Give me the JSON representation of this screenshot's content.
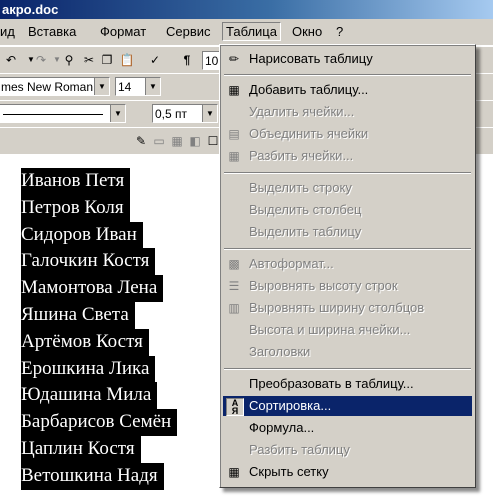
{
  "window": {
    "title": "акро.doc"
  },
  "menubar": [
    "ид",
    "Вставка",
    "Формат",
    "Сервис",
    "Таблица",
    "Окно",
    "?"
  ],
  "toolbar_format": {
    "font": "mes New Roman",
    "size": "14",
    "line_width": "0,5 пт"
  },
  "toolbar_std": {
    "zoom": "10"
  },
  "document": {
    "names": [
      "Иванов Петя",
      "Петров Коля",
      "Сидоров Иван",
      "Галочкин Костя",
      "Мамонтова Лена",
      "Яшина Света",
      "Артёмов Костя",
      "Ерошкина Лика",
      "Юдашина Мила",
      "Барбарисов Семён",
      "Цаплин Костя",
      "Ветошкина Надя"
    ]
  },
  "table_menu": {
    "items": [
      {
        "label": "Нарисовать таблицу",
        "icon": "pencil-icon",
        "enabled": true
      },
      {
        "label": "Добавить таблицу...",
        "icon": "insert-table-icon",
        "enabled": true
      },
      {
        "label": "Удалить ячейки...",
        "icon": "",
        "enabled": false
      },
      {
        "label": "Объединить ячейки",
        "icon": "merge-cells-icon",
        "enabled": false
      },
      {
        "label": "Разбить ячейки...",
        "icon": "split-cells-icon",
        "enabled": false
      },
      {
        "label": "Выделить строку",
        "icon": "",
        "enabled": false
      },
      {
        "label": "Выделить столбец",
        "icon": "",
        "enabled": false
      },
      {
        "label": "Выделить таблицу",
        "icon": "",
        "enabled": false
      },
      {
        "label": "Автоформат...",
        "icon": "autoformat-icon",
        "enabled": false
      },
      {
        "label": "Выровнять высоту строк",
        "icon": "distribute-rows-icon",
        "enabled": false
      },
      {
        "label": "Выровнять ширину столбцов",
        "icon": "distribute-columns-icon",
        "enabled": false
      },
      {
        "label": "Высота и ширина ячейки...",
        "icon": "",
        "enabled": false
      },
      {
        "label": "Заголовки",
        "icon": "",
        "enabled": false
      },
      {
        "label": "Преобразовать в таблицу...",
        "icon": "",
        "enabled": true
      },
      {
        "label": "Сортировка...",
        "icon": "sort-az-icon",
        "enabled": true,
        "highlighted": true
      },
      {
        "label": "Формула...",
        "icon": "",
        "enabled": true
      },
      {
        "label": "Разбить таблицу",
        "icon": "",
        "enabled": false
      },
      {
        "label": "Скрыть сетку",
        "icon": "gridlines-icon",
        "enabled": true
      }
    ]
  },
  "colors": {
    "menu_bg": "#d4d0c8",
    "highlight": "#0a246a",
    "title_bar": "#0a246a"
  }
}
